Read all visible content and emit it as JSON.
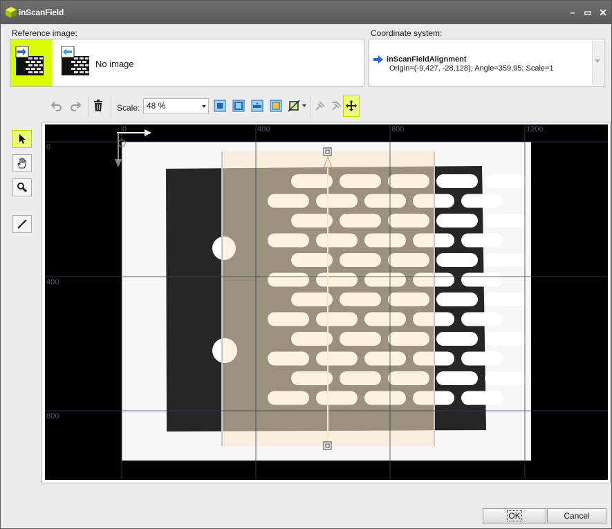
{
  "window": {
    "title": "inScanField",
    "controls": {
      "minimize": "–",
      "maximize": "▭",
      "close": "✕"
    }
  },
  "reference": {
    "label": "Reference image:",
    "no_image_text": "No image"
  },
  "coordinate_system": {
    "label": "Coordinate system:",
    "name": "inScanFieldAlignment",
    "detail": "Origin=(-9,427, -28,128); Angle=359,95; Scale=1"
  },
  "toolbar": {
    "scale_label": "Scale:",
    "scale_value": "48 %",
    "icons": [
      "undo-icon",
      "redo-icon",
      "delete-icon",
      "zoom-fit-icon",
      "zoom-actual-icon",
      "zoom-width-icon",
      "zoom-selection-icon",
      "crop-icon",
      "pin-add-icon",
      "pin-remove-icon",
      "move-icon"
    ]
  },
  "left_tools": [
    "pointer-icon",
    "hand-icon",
    "zoom-icon",
    "line-icon"
  ],
  "rulers": {
    "x_ticks": [
      "0",
      "400",
      "800",
      "1200"
    ],
    "y_ticks": [
      "0",
      "400",
      "800"
    ]
  },
  "colors": {
    "highlight": "#d7ff00",
    "overlay": "#fde8cc",
    "titlebar": "#626262",
    "accent_blue": "#2f62d6"
  },
  "buttons": {
    "ok": "OK",
    "cancel": "Cancel"
  }
}
